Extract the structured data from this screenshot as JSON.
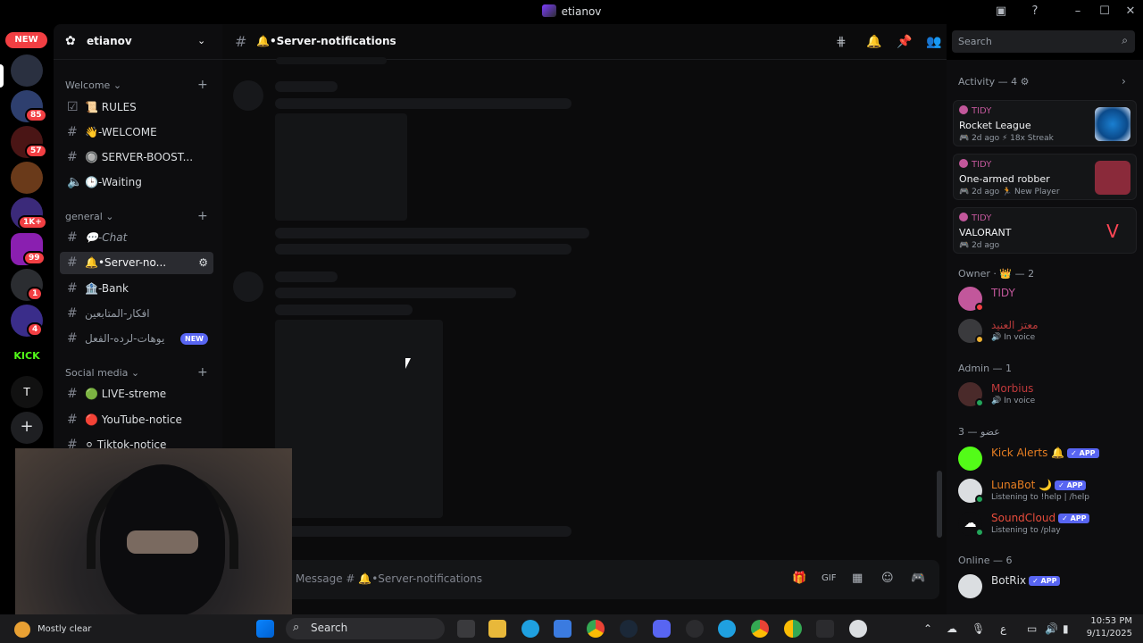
{
  "window": {
    "title": "etianov"
  },
  "rail": {
    "new_label": "NEW",
    "badges": [
      "85",
      "57",
      "1K+",
      "99",
      "1",
      "4"
    ],
    "kick_label": "KICK",
    "t_label": "T"
  },
  "server": {
    "name": "etianov"
  },
  "categories": {
    "welcome": "Welcome",
    "general": "general",
    "social": "Social media"
  },
  "channels": {
    "welcome": [
      {
        "label": "📜 RULES",
        "icon": "checkbox-icon"
      },
      {
        "label": "👋-WELCOME",
        "icon": "hash-icon"
      },
      {
        "label": "🔘 SERVER-BOOST...",
        "icon": "hash-icon"
      },
      {
        "label": "🕒-Waiting",
        "icon": "speaker-icon"
      }
    ],
    "general": [
      {
        "label": "💬-Chat"
      },
      {
        "label": "🔔•Server-no..."
      },
      {
        "label": "🏦-Bank"
      },
      {
        "label": "افكار-المتابعين"
      },
      {
        "label": "يوهات-لرده-الفعل",
        "badge": "NEW"
      }
    ],
    "social": [
      {
        "label": "🟢 LIVE-streme"
      },
      {
        "label": "🔴 YouTube-notice"
      },
      {
        "label": "⚪ Tiktok-notice"
      }
    ]
  },
  "channel_header": {
    "name": "🔔•Server-notifications"
  },
  "search": {
    "placeholder": "Search"
  },
  "composer": {
    "placeholder": "Message # 🔔•Server-notifications"
  },
  "members": {
    "activity_heading": "Activity — 4",
    "activities": [
      {
        "user": "TIDY",
        "game": "Rocket League",
        "meta": "🎮 2d ago  ⚡ 18x Streak",
        "color": "#1a7fd1"
      },
      {
        "user": "TIDY",
        "game": "One-armed robber",
        "meta": "🎮 2d ago  🏃 New Player",
        "color": "#8a2a3a"
      },
      {
        "user": "TIDY",
        "game": "VALORANT",
        "meta": "🎮 2d ago",
        "color": "#141517"
      }
    ],
    "owner_heading": "Owner · 👑 — 2",
    "owner": [
      {
        "name": "TIDY",
        "sub": "",
        "color": "#c2579b"
      },
      {
        "name": "معتز العنيد",
        "sub": "🔊 In voice",
        "color": "#b83a3a"
      }
    ],
    "admin_heading": "Admin — 1",
    "admin": [
      {
        "name": "Morbius",
        "sub": "🔊 In voice",
        "color": "#c0393b"
      }
    ],
    "role_heading": "عضو — 3",
    "role": [
      {
        "name": "Kick Alerts 🔔",
        "sub": "",
        "tag": "✓ APP",
        "color": "#e67e22"
      },
      {
        "name": "LunaBot 🌙",
        "sub": "Listening to !help | /help",
        "tag": "✓ APP",
        "color": "#e67e22"
      },
      {
        "name": "SoundCloud",
        "sub": "Listening to /play",
        "tag": "✓ APP",
        "color": "#e74c3c"
      }
    ],
    "online_heading": "Online — 6",
    "online": [
      {
        "name": "BotRix",
        "sub": "",
        "tag": "✓ APP",
        "color": "#dbdee1"
      }
    ]
  },
  "taskbar": {
    "weather": "Mostly clear",
    "search": "Search",
    "time": "10:53 PM",
    "date": "9/11/2025",
    "lang": "ع"
  }
}
